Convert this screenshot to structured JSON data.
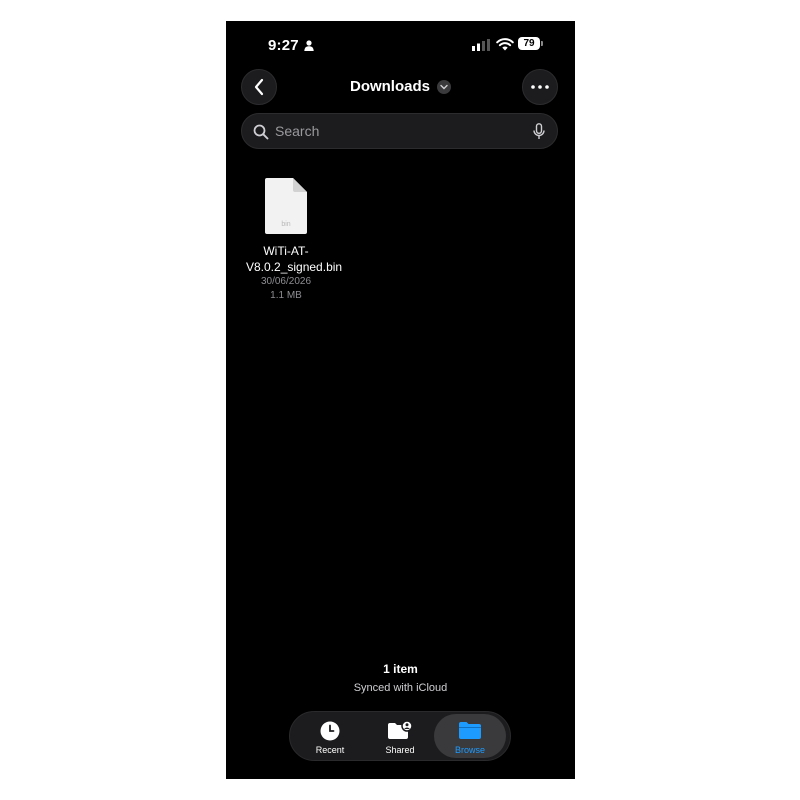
{
  "status_bar": {
    "time": "9:27",
    "battery": "79"
  },
  "nav": {
    "title": "Downloads"
  },
  "search": {
    "placeholder": "Search"
  },
  "files": [
    {
      "name": "WiTi-AT-V8.0.2_signed.bin",
      "type_label": "bin",
      "date": "30/06/2026",
      "size": "1.1 MB"
    }
  ],
  "footer": {
    "count": "1 item",
    "sync_status": "Synced with iCloud"
  },
  "tabs": [
    {
      "label": "Recent",
      "icon": "clock-icon",
      "active": false
    },
    {
      "label": "Shared",
      "icon": "shared-folder-icon",
      "active": false
    },
    {
      "label": "Browse",
      "icon": "folder-icon",
      "active": true
    }
  ],
  "colors": {
    "accent": "#1e9bff",
    "background": "#000000",
    "surface": "#1c1c1e"
  }
}
